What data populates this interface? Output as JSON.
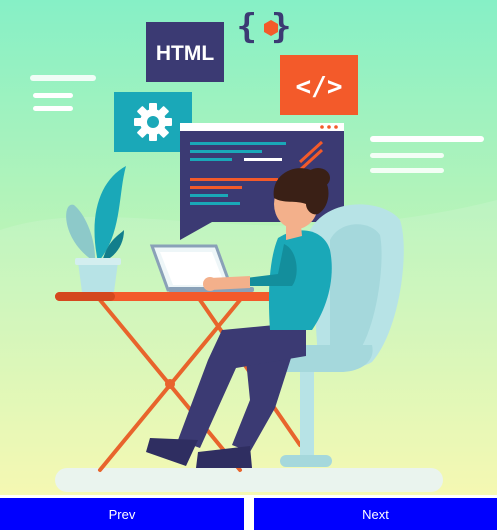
{
  "illustration": {
    "html_badge_text": "HTML",
    "code_tag_text": "</>",
    "braces_text": "{ }",
    "colors": {
      "bg_top": "#86f0c6",
      "bg_bottom": "#f4f8a8",
      "navy": "#3b3a73",
      "teal": "#1aa8b8",
      "orange": "#f35a2a",
      "chair": "#b7e3e6",
      "skin": "#f3b08b",
      "hair": "#3a2016"
    }
  },
  "nav": {
    "prev_label": "Prev",
    "next_label": "Next",
    "button_color": "#0000ff"
  }
}
